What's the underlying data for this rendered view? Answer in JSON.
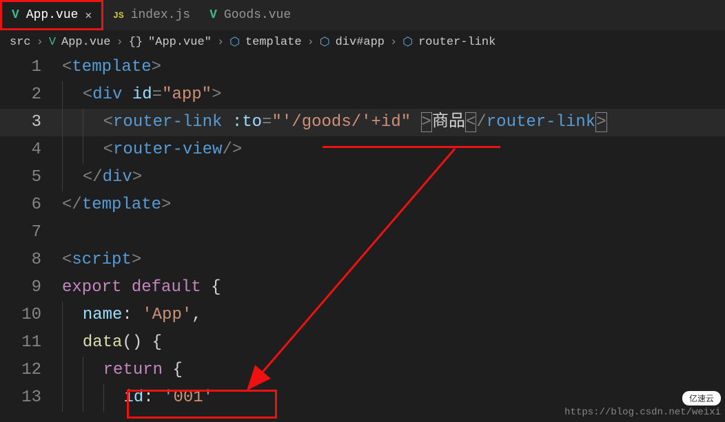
{
  "tabs": [
    {
      "icon": "V",
      "label": "App.vue",
      "active": true,
      "closeable": true
    },
    {
      "icon": "JS",
      "label": "index.js",
      "active": false,
      "closeable": false
    },
    {
      "icon": "V",
      "label": "Goods.vue",
      "active": false,
      "closeable": false
    }
  ],
  "breadcrumb": {
    "items": [
      "src",
      "App.vue",
      "\"App.vue\"",
      "template",
      "div#app",
      "router-link"
    ]
  },
  "code": {
    "lines": [
      {
        "n": "1"
      },
      {
        "n": "2"
      },
      {
        "n": "3"
      },
      {
        "n": "4"
      },
      {
        "n": "5"
      },
      {
        "n": "6"
      },
      {
        "n": "7"
      },
      {
        "n": "8"
      },
      {
        "n": "9"
      },
      {
        "n": "10"
      },
      {
        "n": "11"
      },
      {
        "n": "12"
      },
      {
        "n": "13"
      }
    ],
    "tokens": {
      "template": "template",
      "div": "div",
      "id": "id",
      "app_str": "\"app\"",
      "router_link": "router-link",
      "to_attr": ":to",
      "to_val": "\"'/goods/'+id\"",
      "link_text": "商品",
      "router_view": "router-view",
      "script": "script",
      "export": "export",
      "default": "default",
      "name_key": "name",
      "app_val": "'App'",
      "data_fn": "data",
      "return": "return",
      "id_key": "id",
      "id_val": "'001'"
    }
  },
  "watermark": "https://blog.csdn.net/weixi",
  "badge": "亿速云"
}
